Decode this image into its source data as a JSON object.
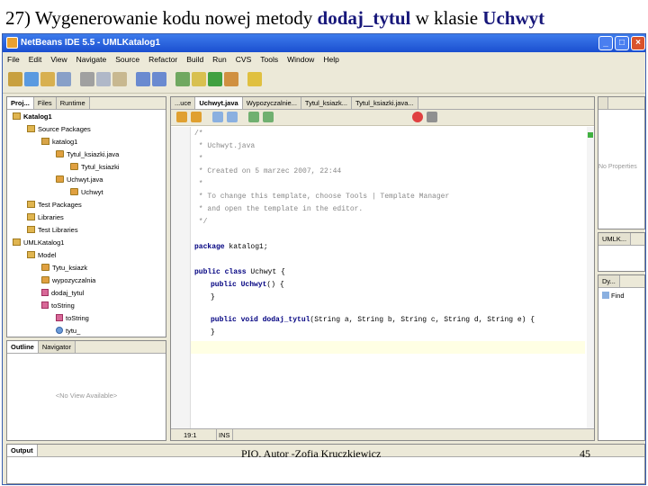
{
  "slide": {
    "title_prefix": "27) Wygenerowanie kodu nowej metody ",
    "title_method": "dodaj_tytul",
    "title_mid": " w klasie ",
    "title_class": "Uchwyt",
    "footer": "PIO.  Autor -Zofia Kruczkiewicz",
    "number": "45"
  },
  "window": {
    "title": "NetBeans IDE 5.5 - UMLKatalog1"
  },
  "menu": [
    "File",
    "Edit",
    "View",
    "Navigate",
    "Source",
    "Refactor",
    "Build",
    "Run",
    "CVS",
    "Tools",
    "Window",
    "Help"
  ],
  "projects": {
    "tabs": [
      "Proj...",
      "Files",
      "Runtime"
    ],
    "tree": [
      {
        "label": "Katalog1",
        "icon": "project-icon"
      },
      {
        "label": "Source Packages",
        "icon": "folder-icon"
      },
      {
        "label": "katalog1",
        "icon": "package-icon"
      },
      {
        "label": "Tytul_ksiazki.java",
        "icon": "java-file-icon"
      },
      {
        "label": "Tytul_ksiazki",
        "icon": "class-icon"
      },
      {
        "label": "Uchwyt.java",
        "icon": "java-file-icon"
      },
      {
        "label": "Uchwyt",
        "icon": "class-icon"
      },
      {
        "label": "Test Packages",
        "icon": "folder-icon"
      },
      {
        "label": "Libraries",
        "icon": "folder-icon"
      },
      {
        "label": "Test Libraries",
        "icon": "folder-icon"
      },
      {
        "label": "UMLKatalog1",
        "icon": "uml-project-icon"
      },
      {
        "label": "Model",
        "icon": "folder-icon"
      },
      {
        "label": "Tytu_ksiazk",
        "icon": "class-icon"
      },
      {
        "label": "wypozyczalnia",
        "icon": "class-icon"
      },
      {
        "label": "dodaj_tytul",
        "icon": "method-icon"
      },
      {
        "label": "toString",
        "icon": "method-icon"
      },
      {
        "label": "toString",
        "icon": "method-icon"
      },
      {
        "label": "tytu_",
        "icon": "field-icon"
      }
    ]
  },
  "navigator": {
    "tabs": [
      "Outline",
      "Navigator"
    ],
    "empty_text": "<No View Available>"
  },
  "editor": {
    "tabs": [
      "...uce",
      "Uchwyt.java",
      "Wypozyczalnie...",
      "Tytul_ksiazk...",
      "Tytul_ksiazki.java..."
    ],
    "comment_lines": [
      "/*",
      " * Uchwyt.java",
      " *",
      " * Created on 5 marzec 2007, 22:44",
      " *",
      " * To change this template, choose Tools | Template Manager",
      " * and open the template in the editor.",
      " */"
    ],
    "package_kw": "package",
    "package_name": " katalog1;",
    "class_decl_kw": "public class",
    "class_decl_rest": " Uchwyt {",
    "ctor_kw": "public",
    "ctor_name": " Uchwyt",
    "ctor_rest": "() {",
    "ctor_close": "}",
    "method_kw": "public void",
    "method_name": " dodaj_tytul",
    "method_rest": "(String a, String b, String c, String d, String e) {",
    "method_close": "}",
    "cursor_pos": "19:1",
    "insert_mode": "INS"
  },
  "right_panel": {
    "properties_text": "No Properties",
    "uml_label": "UMLK...",
    "dynamic_label": "Dy...",
    "find_label": "Find"
  },
  "output": {
    "label": "Output"
  },
  "colors": {
    "title_highlight": "#17177a",
    "titlebar": "#1b4fd0",
    "keyword": "#000080"
  }
}
